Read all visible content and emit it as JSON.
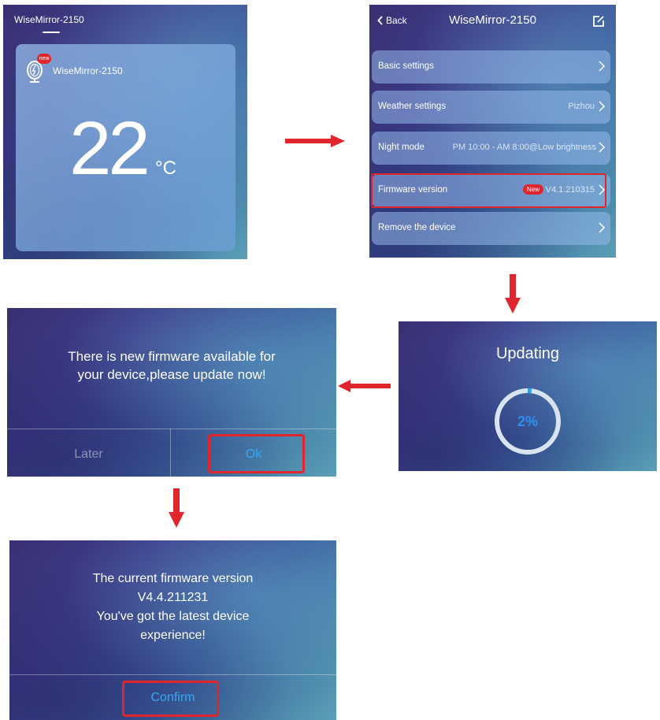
{
  "colors": {
    "highlight": "#e0262c",
    "accent_blue": "#37a7f0",
    "progress_blue": "#2f8ff0"
  },
  "home": {
    "header_title": "WiseMirror-2150",
    "device_name": "WiseMirror-2150",
    "badge": "new",
    "temperature": "22",
    "unit": "°C",
    "icon": "mirror-device-icon"
  },
  "settings": {
    "back_label": "Back",
    "title": "WiseMirror-2150",
    "rows": [
      {
        "label": "Basic settings",
        "value": ""
      },
      {
        "label": "Weather settings",
        "value": "Pizhou"
      },
      {
        "label": "Night mode",
        "value": "PM 10:00 - AM 8:00@Low brightness"
      },
      {
        "label": "Firmware version",
        "value": "V4.1.210315",
        "badge": "New"
      },
      {
        "label": "Remove the device",
        "value": ""
      }
    ]
  },
  "update_prompt": {
    "message_line1": "There is new firmware available for",
    "message_line2": "your device,please update now!",
    "later_label": "Later",
    "ok_label": "Ok"
  },
  "updating": {
    "title": "Updating",
    "percent_label": "2%",
    "progress": 0.02
  },
  "latest": {
    "line1": "The current firmware version",
    "line2": "V4.4.211231",
    "line3": "You've got the latest device",
    "line4": "experience!",
    "confirm_label": "Confirm"
  }
}
